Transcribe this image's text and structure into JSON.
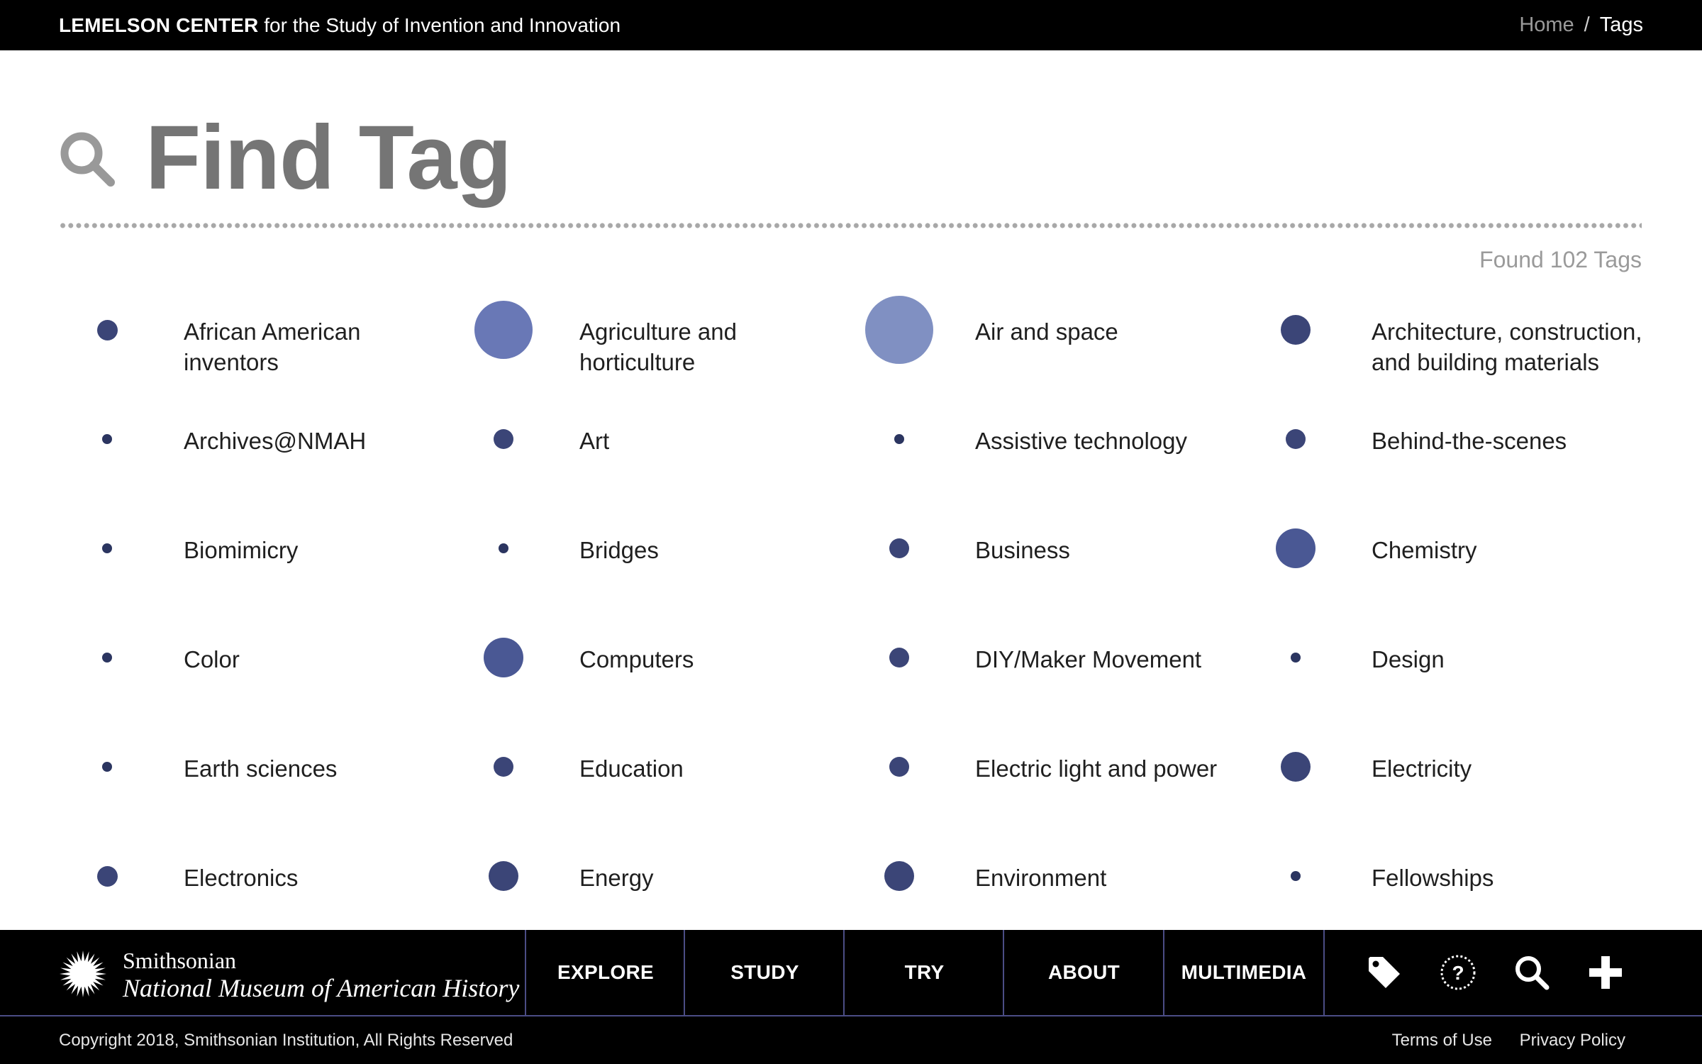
{
  "header": {
    "brand_bold": "LEMELSON CENTER",
    "brand_rest": " for the Study of Invention and Innovation",
    "breadcrumb": {
      "home": "Home",
      "separator": "/",
      "current": "Tags"
    }
  },
  "find": {
    "title": "Find Tag",
    "icon": "search-icon",
    "found_text": "Found 102 Tags"
  },
  "tags": [
    {
      "label": "African American\ninventors",
      "size": "m"
    },
    {
      "label": "Agriculture and\nhorticulture",
      "size": "xl"
    },
    {
      "label": "Air and space",
      "size": "xxl"
    },
    {
      "label": "Architecture, construction,\nand building materials",
      "size": "ml"
    },
    {
      "label": "Archives@NMAH",
      "size": "xs"
    },
    {
      "label": "Art",
      "size": "s"
    },
    {
      "label": "Assistive technology",
      "size": "xs"
    },
    {
      "label": "Behind-the-scenes",
      "size": "s"
    },
    {
      "label": "Biomimicry",
      "size": "xs"
    },
    {
      "label": "Bridges",
      "size": "xs"
    },
    {
      "label": "Business",
      "size": "s"
    },
    {
      "label": "Chemistry",
      "size": "l"
    },
    {
      "label": "Color",
      "size": "xs"
    },
    {
      "label": "Computers",
      "size": "l"
    },
    {
      "label": "DIY/Maker Movement",
      "size": "s"
    },
    {
      "label": "Design",
      "size": "xs"
    },
    {
      "label": "Earth sciences",
      "size": "xs"
    },
    {
      "label": "Education",
      "size": "s"
    },
    {
      "label": "Electric light and power",
      "size": "s"
    },
    {
      "label": "Electricity",
      "size": "ml"
    },
    {
      "label": "Electronics",
      "size": "m"
    },
    {
      "label": "Energy",
      "size": "ml"
    },
    {
      "label": "Environment",
      "size": "ml"
    },
    {
      "label": "Fellowships",
      "size": "xs"
    }
  ],
  "nav": {
    "logo_line1": "Smithsonian",
    "logo_line2": "National Museum of American History",
    "items": [
      "EXPLORE",
      "STUDY",
      "TRY",
      "ABOUT",
      "MULTIMEDIA"
    ],
    "icons": [
      "tag-icon",
      "help-icon",
      "search-icon",
      "plus-icon"
    ]
  },
  "footer": {
    "copyright": "Copyright 2018, Smithsonian Institution, All Rights Reserved",
    "links": [
      "Terms of Use",
      "Privacy Policy"
    ]
  },
  "colors": {
    "dot_small": "#2b3560",
    "dot_medium": "#3b4577",
    "dot_large": "#4a5894",
    "dot_xl": "#6978b6",
    "dot_xxl": "#8090c2",
    "nav_divider": "#4b4d85"
  }
}
